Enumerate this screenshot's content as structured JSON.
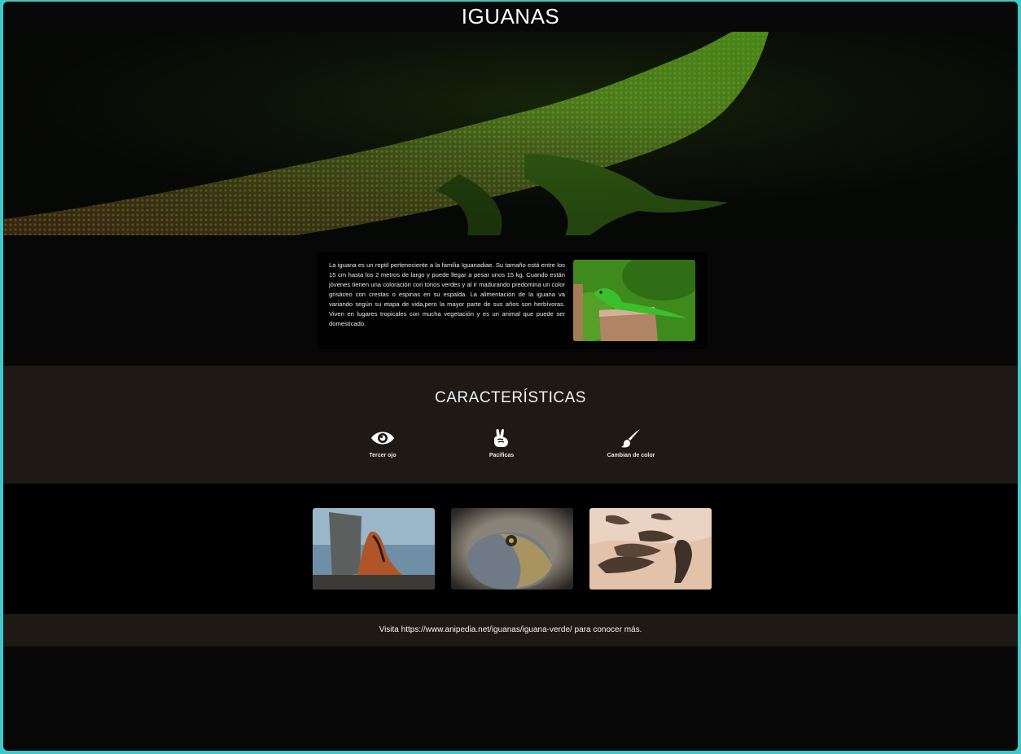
{
  "header": {
    "title": "IGUANAS"
  },
  "intro": {
    "text": "La iguana es un reptil perteneciente a la familia Iguanadiae. Su tamaño está entre los 15 cm hasta los 2 metros de largo y puede llegar a pesar unos 15 kg. Cuando están jóvenes tienen una coloración con tonos verdes y al ir madurando predomina un color grisáceo con crestas o espinas en su espalda. La alimentación de la iguana va variando según su etapa de vida,pero la mayor parte de sus años son herbívoras. Viven en lugares tropicales con mucha vegetación y es un animal que puede ser domesticado."
  },
  "features": {
    "title": "CARACTERÍSTICAS",
    "items": [
      {
        "label": "Tercer ojo",
        "icon": "eye-icon"
      },
      {
        "label": "Pacificas",
        "icon": "peace-hand-icon"
      },
      {
        "label": "Cambian de color",
        "icon": "paintbrush-icon"
      }
    ]
  },
  "footer": {
    "text": "Visita https://www.anipedia.net/iguanas/iguana-verde/ para conocer más."
  },
  "colors": {
    "page_border": "#3fc7c9",
    "background": "#070707",
    "section_brown": "#1e1915",
    "text": "#ffffff"
  }
}
